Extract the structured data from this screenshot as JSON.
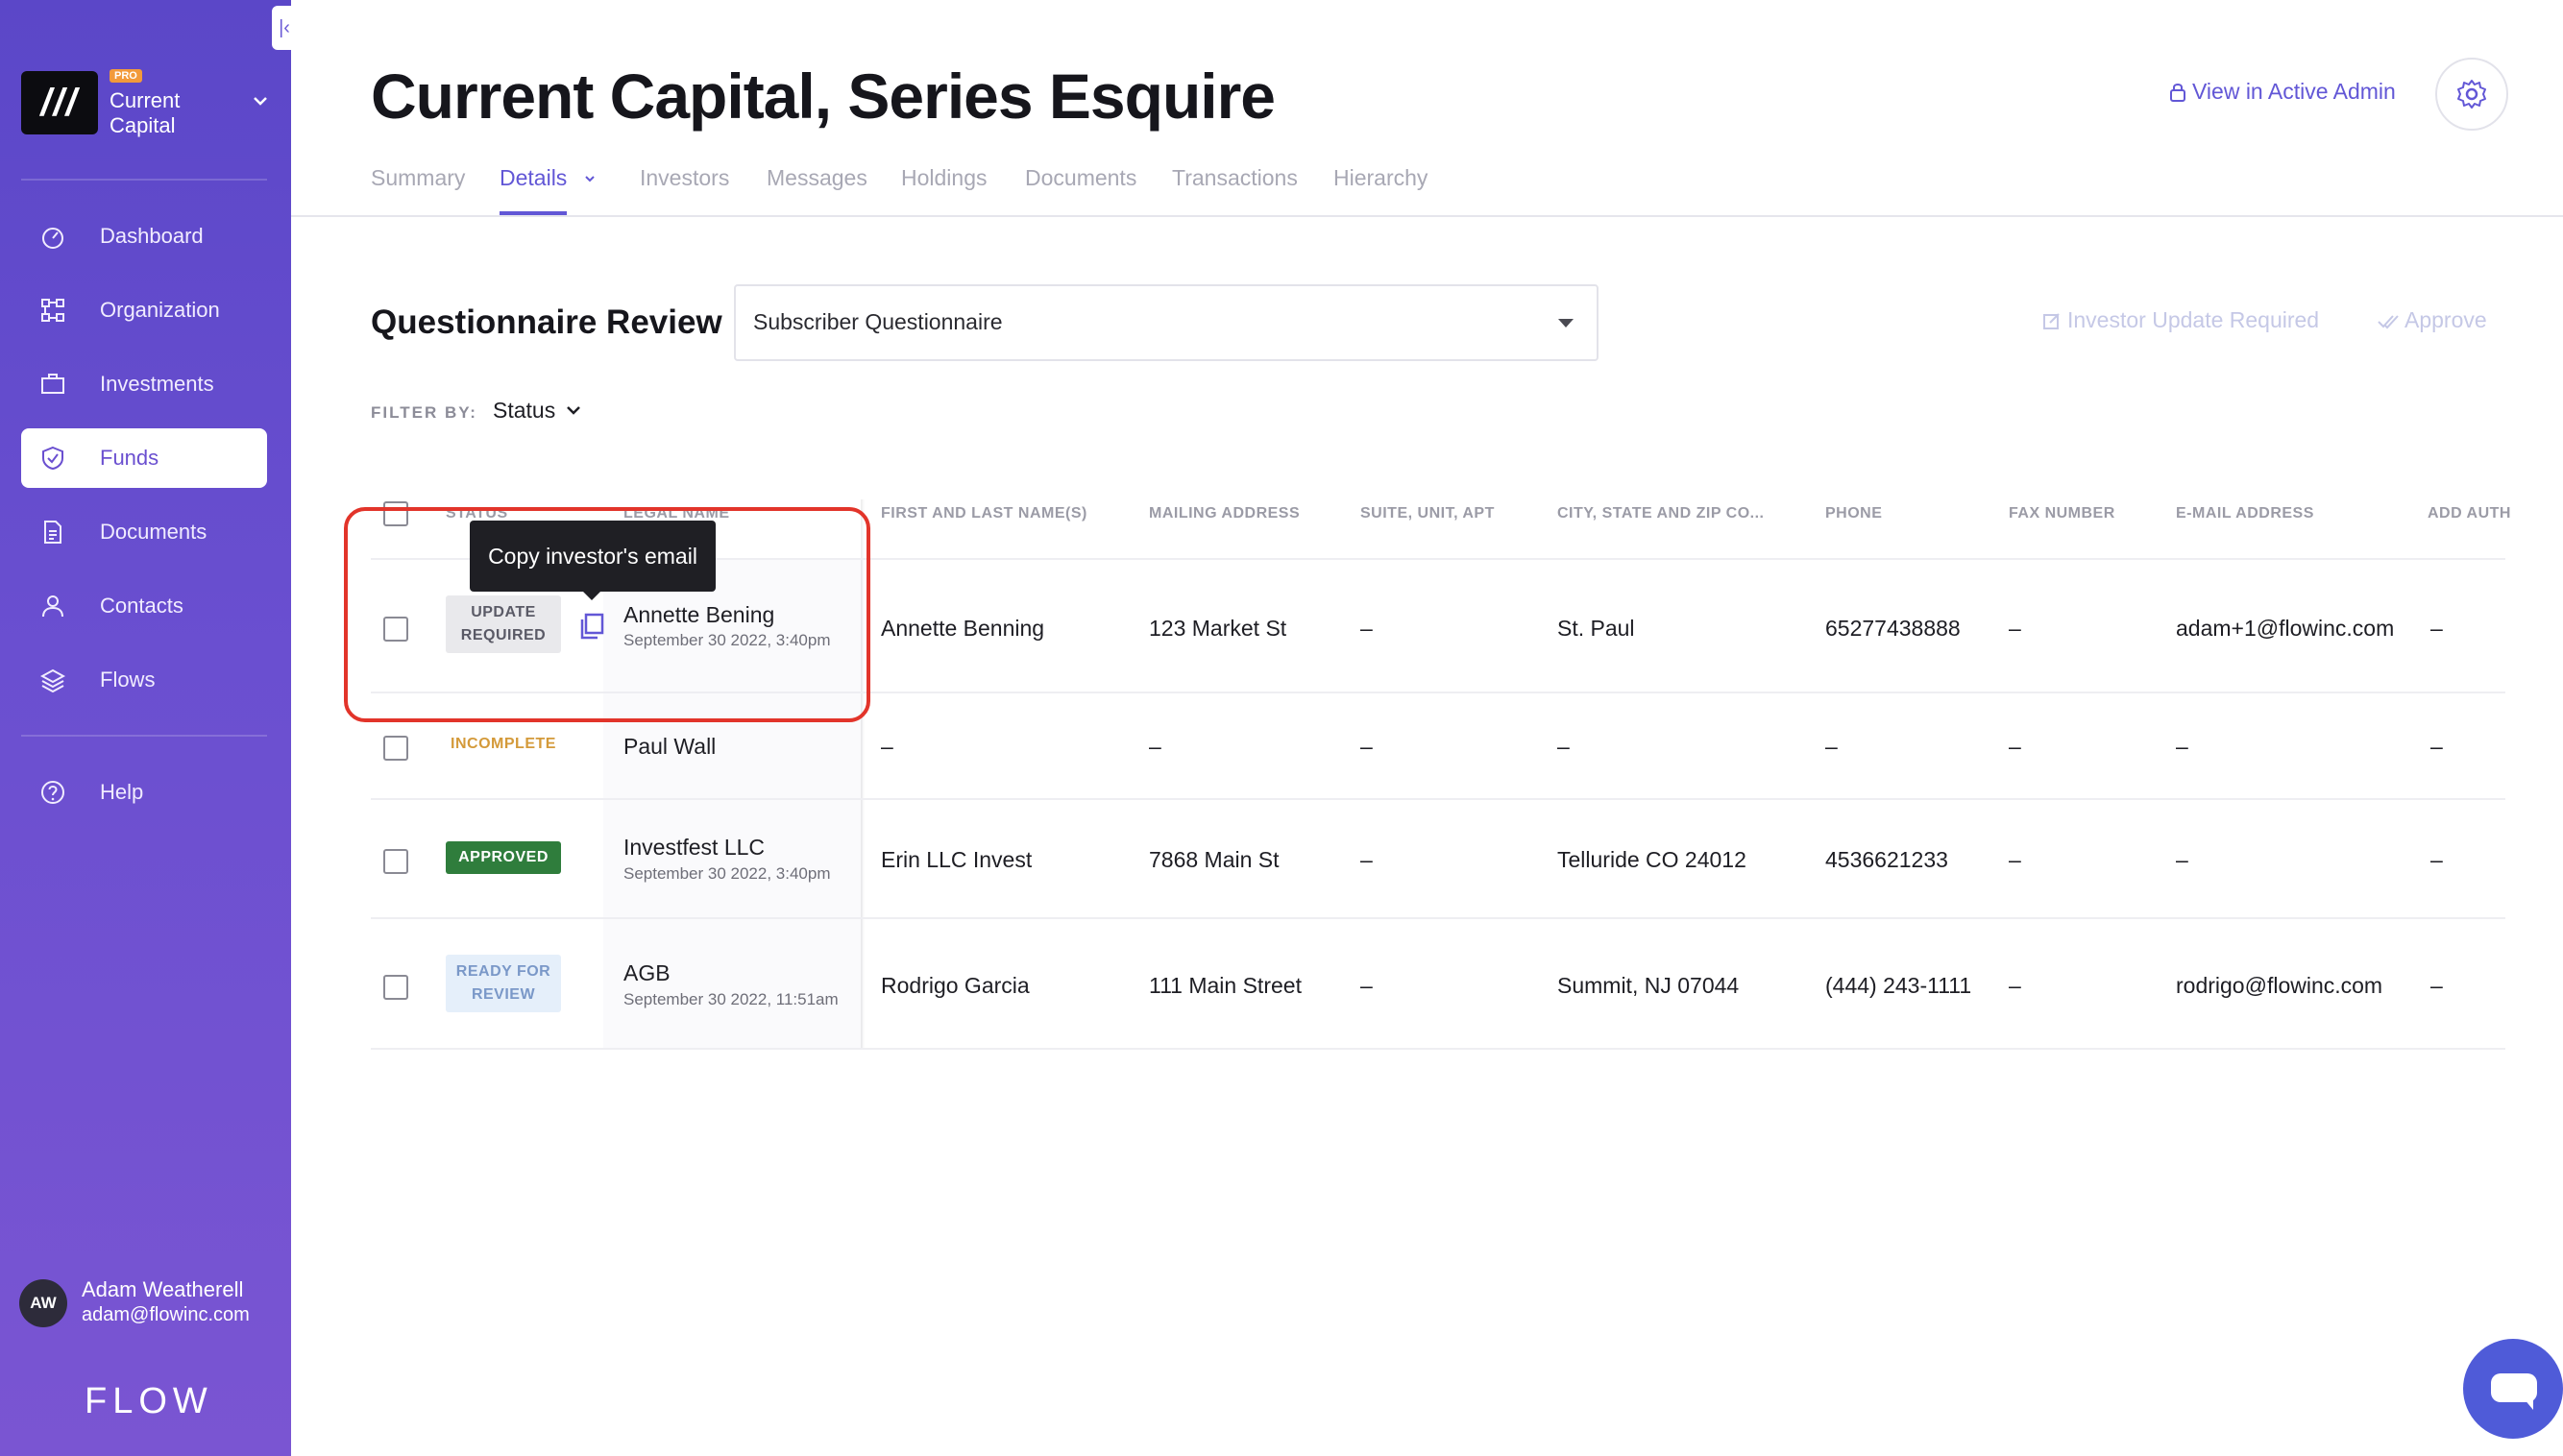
{
  "sidebar": {
    "collapse_glyph": "|‹",
    "org": {
      "badge": "PRO",
      "name": "Current Capital",
      "logo_text": "///"
    },
    "items": [
      {
        "label": "Dashboard",
        "icon": "gauge-icon"
      },
      {
        "label": "Organization",
        "icon": "org-chart-icon"
      },
      {
        "label": "Investments",
        "icon": "briefcase-icon"
      },
      {
        "label": "Funds",
        "icon": "shield-check-icon",
        "active": true
      },
      {
        "label": "Documents",
        "icon": "document-icon"
      },
      {
        "label": "Contacts",
        "icon": "person-icon"
      },
      {
        "label": "Flows",
        "icon": "layers-icon"
      }
    ],
    "help": {
      "label": "Help",
      "icon": "question-icon"
    },
    "user": {
      "initials": "AW",
      "name": "Adam Weatherell",
      "email": "adam@flowinc.com"
    },
    "brand": "FLOW"
  },
  "header": {
    "title": "Current Capital, Series Esquire",
    "admin_link": "View in Active Admin",
    "tabs": [
      "Summary",
      "Details",
      "Investors",
      "Messages",
      "Holdings",
      "Documents",
      "Transactions",
      "Hierarchy"
    ],
    "active_tab": "Details"
  },
  "review": {
    "title": "Questionnaire Review",
    "questionnaire_selected": "Subscriber Questionnaire",
    "actions": {
      "update_required": "Investor Update Required",
      "approve": "Approve"
    },
    "filter_label": "FILTER BY:",
    "filter_value": "Status"
  },
  "table": {
    "columns": [
      "STATUS",
      "LEGAL NAME",
      "FIRST AND LAST NAME(S)",
      "MAILING ADDRESS",
      "SUITE, UNIT, APT",
      "CITY, STATE AND ZIP CO...",
      "PHONE",
      "FAX NUMBER",
      "E-MAIL ADDRESS",
      "ADD AUTH"
    ],
    "rows": [
      {
        "status": "UPDATE REQUIRED",
        "status_line1": "UPDATE",
        "status_line2": "REQUIRED",
        "legal_name": "Annette Bening",
        "date": "September 30 2022, 3:40pm",
        "first_last": "Annette Benning",
        "mailing": "123 Market St",
        "suite": "–",
        "city": "St. Paul",
        "phone": "65277438888",
        "fax": "–",
        "email": "adam+1@flowinc.com",
        "add_auth": "–"
      },
      {
        "status": "INCOMPLETE",
        "legal_name": "Paul Wall",
        "date": "",
        "first_last": "–",
        "mailing": "–",
        "suite": "–",
        "city": "–",
        "phone": "–",
        "fax": "–",
        "email": "–",
        "add_auth": "–"
      },
      {
        "status": "APPROVED",
        "legal_name": "Investfest LLC",
        "date": "September 30 2022, 3:40pm",
        "first_last": "Erin LLC Invest",
        "mailing": "7868 Main St",
        "suite": "–",
        "city": "Telluride CO 24012",
        "phone": "4536621233",
        "fax": "–",
        "email": "–",
        "add_auth": "–"
      },
      {
        "status": "READY FOR REVIEW",
        "status_line1": "READY FOR",
        "status_line2": "REVIEW",
        "legal_name": "AGB",
        "date": "September 30 2022, 11:51am",
        "first_last": "Rodrigo Garcia",
        "mailing": "111 Main Street",
        "suite": "–",
        "city": "Summit, NJ 07044",
        "phone": "(444) 243-1111",
        "fax": "–",
        "email": "rodrigo@flowinc.com",
        "add_auth": "–"
      }
    ]
  },
  "tooltip": {
    "text": "Copy investor's email"
  },
  "colors": {
    "accent": "#6257d6",
    "sidebar": "#6a4fd0",
    "approved": "#2f7d3c",
    "incomplete": "#d49a3a",
    "highlight": "#e2342a"
  }
}
